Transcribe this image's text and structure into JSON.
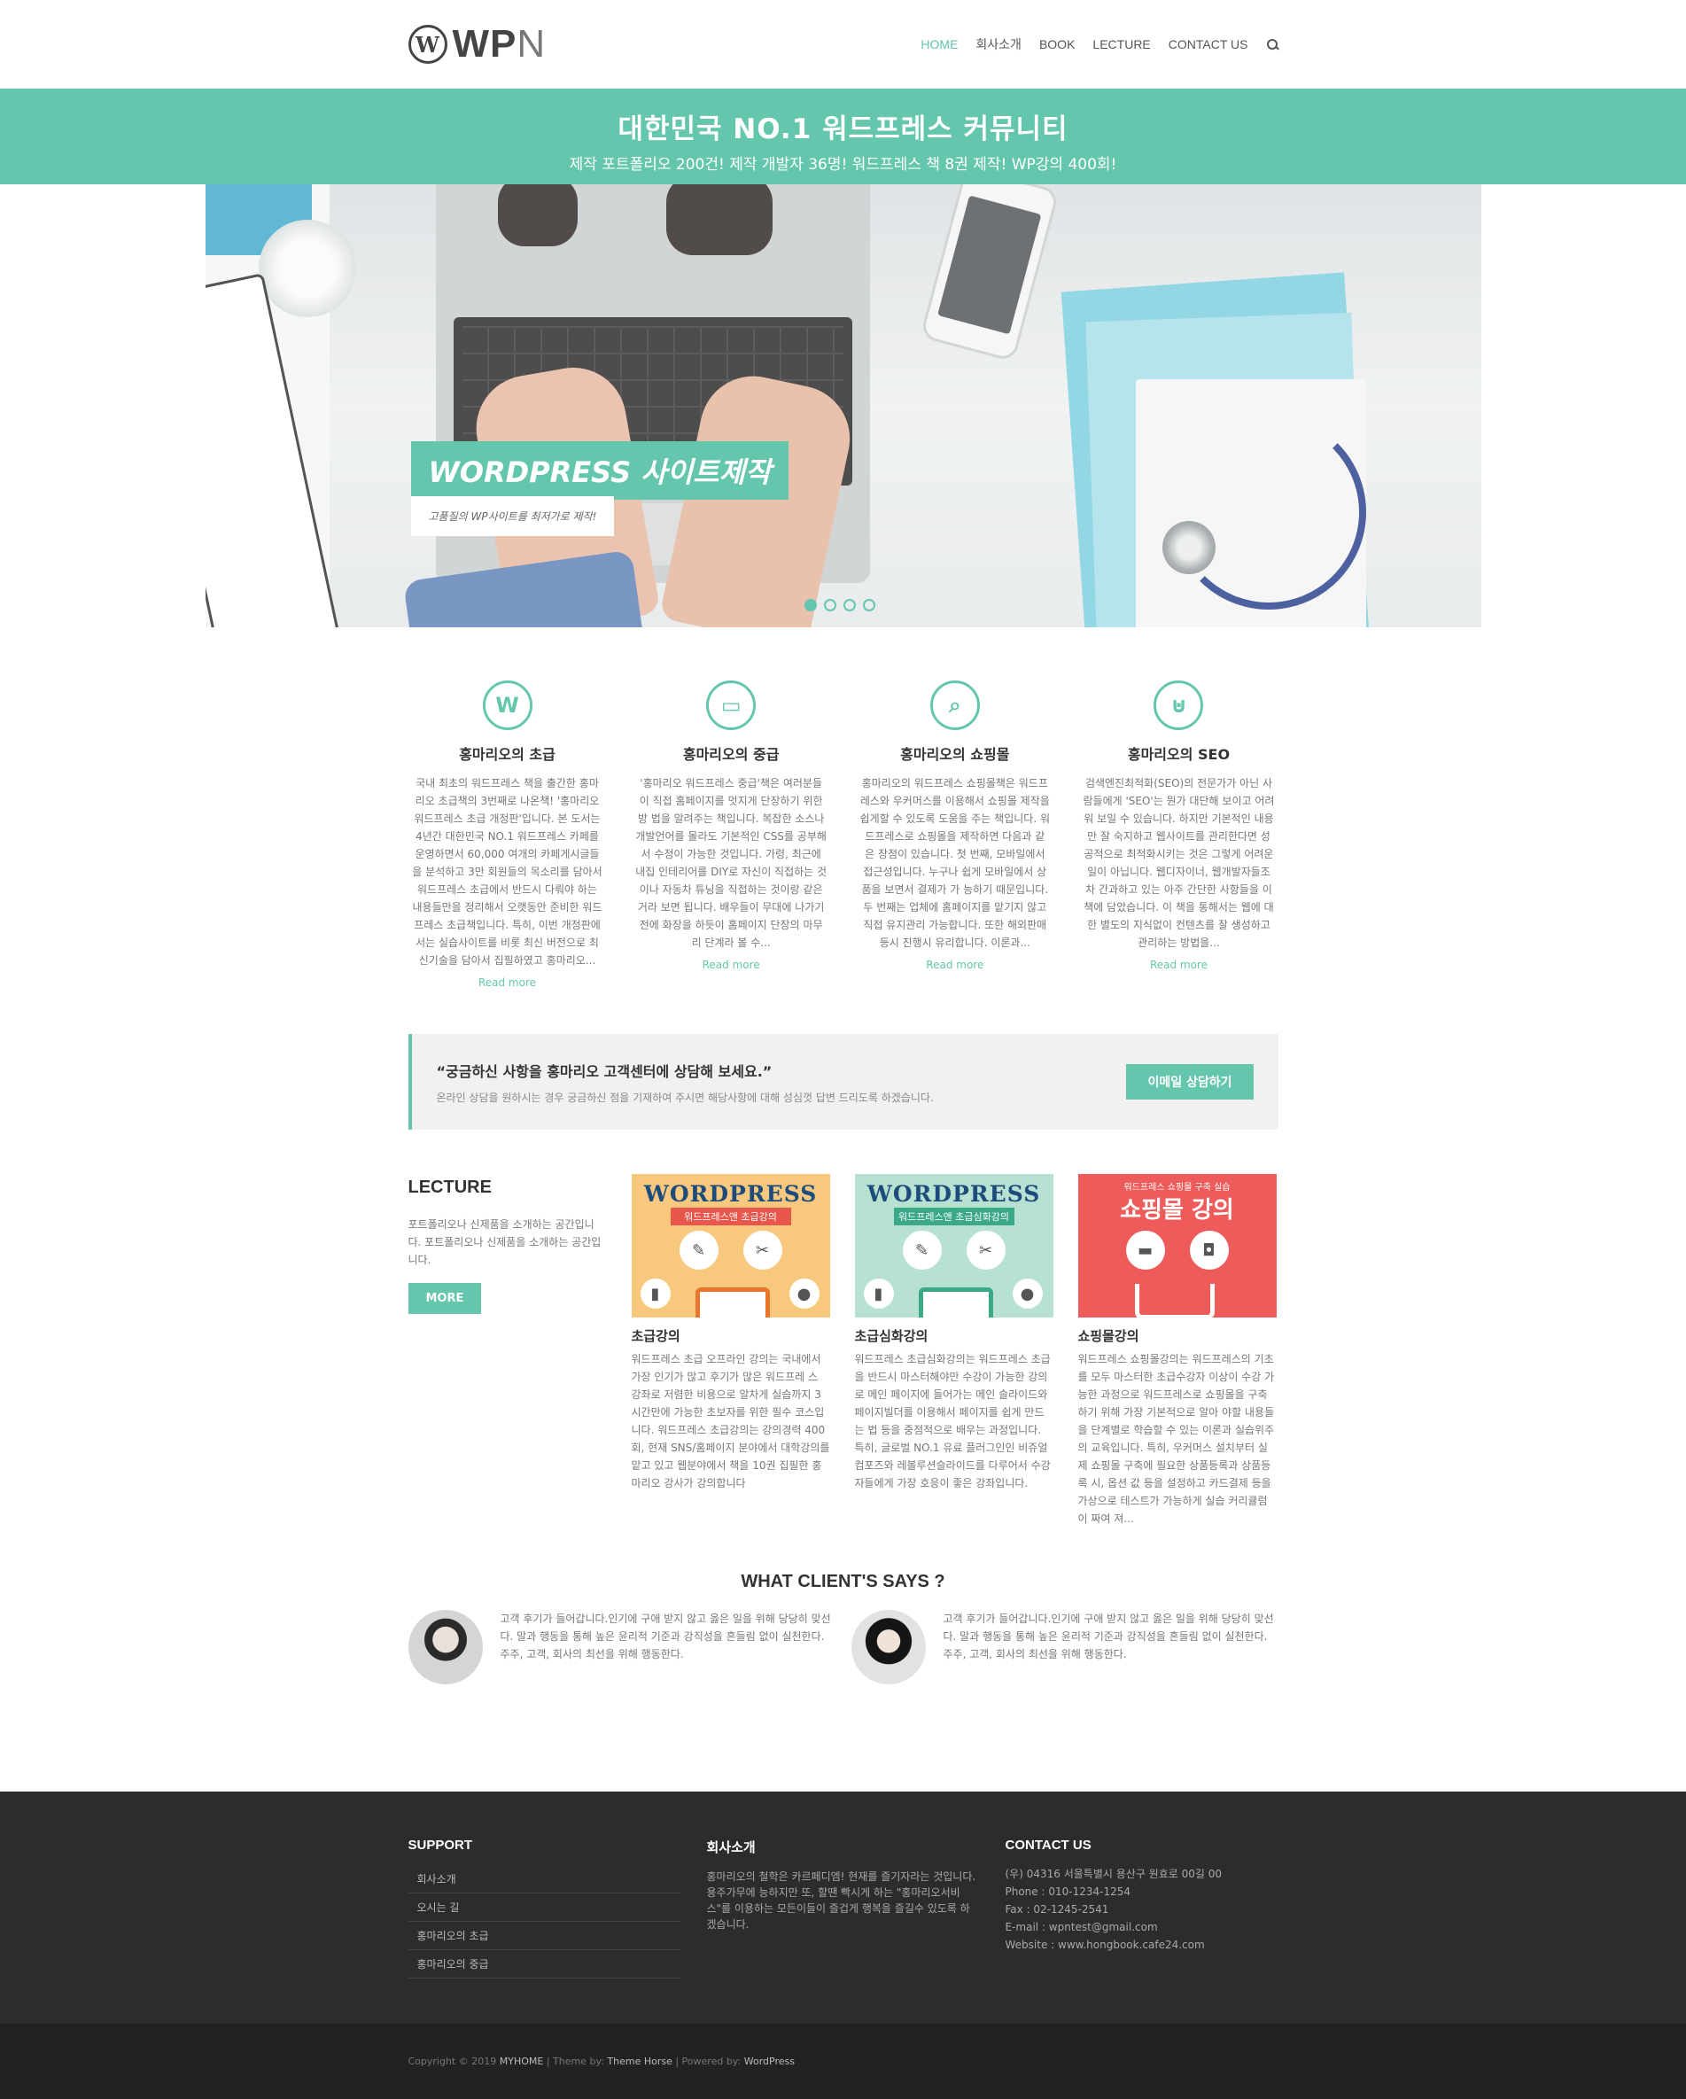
{
  "header": {
    "logo_text_main": "WP",
    "logo_text_n": "N",
    "logo_symbol": "W",
    "nav": [
      "HOME",
      "회사소개",
      "BOOK",
      "LECTURE",
      "CONTACT US"
    ],
    "active_nav": "HOME",
    "search_icon": "search-icon"
  },
  "banner": {
    "title": "대한민국 NO.1 워드프레스 커뮤니티",
    "subtitle": "제작 포트폴리오 200건! 제작 개발자 36명! 워드프레스 책 8권 제작! WP강의 400회!"
  },
  "hero": {
    "caption_title": "WORDPRESS 사이트제작",
    "caption_sub": "고품질의 WP사이트를 최저가로 제작!",
    "slide_count": 4,
    "active_slide": 1
  },
  "features": [
    {
      "icon": "wordpress-icon",
      "glyph": "W",
      "title": "홍마리오의 초급",
      "text": "국내 최초의 워드프레스 책을 출간한 홍마리오 초급책의 3번째로 나온책! '홍마리오 워드프레스 초급 개정판'입니다. 본 도서는 4년간 대한민국 NO.1 워드프레스 카페를 운영하면서 60,000 여개의 카페게시글들을 분석하고 3만 회원들의 목소리를 담아서 워드프레스 초급에서 반드시 다뤄야 하는 내용들만을 정리해서 오랫동안 준비한 워드프레스 초급책입니다. 특히, 이번 개정판에서는 실습사이트를 비롯 최신 버전으로 최신기술을 담아서 집필하였고 홍마리오...",
      "more": "Read more"
    },
    {
      "icon": "monitor-icon",
      "glyph": "▭",
      "title": "홍마리오의 중급",
      "text": "'홍마리오 워드프레스 중급'책은 여러분들이 직접 홈페이지를 멋지게 단장하기 위한 방 법을 알려주는 책입니다. 복잡한 소스나 개발언어를 몰라도 기본적인 CSS를 공부해서 수정이 가능한 것입니다. 가령, 최근에 내집 인테리어를 DIY로 자신이 직접하는 것이나 자동차 튜닝을 직접하는 것이랑 같은거라 보면 됩니다. 배우들이 무대에 나가기 전에 화장을 하듯이 홈페이지 단장의 마무리 단계라 볼 수...",
      "more": "Read more"
    },
    {
      "icon": "search-icon",
      "glyph": "⌕",
      "title": "홍마리오의 쇼핑몰",
      "text": "홍마리오의 워드프레스 쇼핑몰책은 워드프레스와 우커머스를 이용해서 쇼핑몰 제작을 쉽게할 수 있도록 도움을 주는 책입니다. 워드프레스로 쇼핑몰을 제작하면 다음과 같 은 장점이 있습니다. 첫 번째, 모바일에서 접근성입니다. 누구나 쉽게 모바일에서 상품을 보면서 결제가 가 능하기 때문입니다. 두 번째는 업체에 홈페이지를 맡기지 않고 직접 유지관리 가능합니다. 또한 해외판매 등시 진행시 유리합니다. 이론과...",
      "more": "Read more"
    },
    {
      "icon": "basket-icon",
      "glyph": "⊍",
      "title": "홍마리오의 SEO",
      "text": "검색엔진최적화(SEO)의 전문가가 아닌 사람들에게 'SEO'는 뭔가 대단해 보이고 어려 워 보일 수 있습니다. 하지만 기본적인 내용만 잘 숙지하고 웹사이트를 관리한다면 성공적으로 최적화시키는 것은 그렇게 어려운 일이 아닙니다. 웹디자이너, 웹개발자들조차 간과하고 있는 아주 간단한 사항들을 이 책에 담았습니다. 이 책을 통해서는 웹에 대한 별도의 지식없이 컨텐츠를 잘 생성하고 관리하는 방법을...",
      "more": "Read more"
    }
  ],
  "callout": {
    "title": "“궁금하신 사항을 홍마리오 고객센터에 상담해 보세요.”",
    "text": "온라인 상담을 원하시는 경우 궁금하신 점을 기재하여 주시면 해당사항에 대해 성심껏 답변 드리도록 하겠습니다.",
    "button": "이메일 상담하기"
  },
  "lecture": {
    "title": "LECTURE",
    "text": "포트폴리오나 신제품을 소개하는 공간입니다. 포트폴리오나 신제품을 소개하는 공간입니다.",
    "button": "MORE",
    "cards": [
      {
        "thumb_brand": "WORDPRESS",
        "thumb_ribbon": "워드프레스앤 초급강의",
        "title": "초급강의",
        "text": "워드프레스 초급 오프라인 강의는 국내에서 가장 인기가 많고 후기가 많은 워드프레 스 강좌로 저렴한 비용으로 알차게 실습까지 3시간만에 가능한 초보자를 위한 필수 코스입니다. 워드프레스 초급강의는 강의경력 400회, 현재 SNS/홈페이지 분야에서 대학강의를 맡고 있고 웹분야에서 책을 10권 집필한 홍마리오 강사가 강의합니다"
      },
      {
        "thumb_brand": "WORDPRESS",
        "thumb_ribbon": "워드프레스앤 초급심화강의",
        "title": "초급심화강의",
        "text": "워드프레스 초급심화강의는 워드프레스 초급을 반드시 마스터해야만 수강이 가능한 강의로 메인 페이지에 들어가는 메인 슬라이드와 페이지빌더를 이용해서 페이지를 쉽게 만드는 법 등을 중점적으로 배우는 과정입니다. 특히, 글로벌 NO.1 유료 플러그인인 비쥬얼컴포즈와 레볼루션슬라이드를 다루어서 수강자들에게 가장 호응이 좋은 강좌입니다."
      },
      {
        "thumb_small": "워드프레스 쇼핑몰 구축 실습",
        "thumb_title": "쇼핑몰 강의",
        "title": "쇼핑몰강의",
        "text": "워드프레스 쇼핑몰강의는 워드프레스의 기초를 모두 마스터한 초급수강자 이상이 수강 가능한 과정으로 워드프레스로 쇼핑몰을 구축하기 위해 가장 기본적으로 알아 야할 내용들을 단계별로 학습할 수 있는 이론과 실습위주의 교육입니다. 특히, 우커머스 설치부터 실제 쇼핑몰 구축에 필요한 상품등록과 상품등록 시, 옵션 값 등을 설정하고 카드결제 등을 가상으로 테스트가 가능하게 실습 커리큘럼이 짜여 져..."
      }
    ]
  },
  "clients": {
    "title": "WHAT CLIENT'S SAYS ?",
    "items": [
      {
        "text": "고객 후기가 들어갑니다.인기에 구애 받지 않고 옳은 일을 위해 당당히 맞선다. 말과 행동을 통해 높은 윤리적 기준과 강직성을 흔들림 없이 실천한다. 주주, 고객, 회사의 최선을 위해 행동한다."
      },
      {
        "text": "고객 후기가 들어갑니다.인기에 구애 받지 않고 옳은 일을 위해 당당히 맞선다. 말과 행동을 통해 높은 윤리적 기준과 강직성을 흔들림 없이 실천한다. 주주, 고객, 회사의 최선을 위해 행동한다."
      }
    ]
  },
  "footer": {
    "support_title": "SUPPORT",
    "support_links": [
      "회사소개",
      "오시는 길",
      "홍마리오의 초급",
      "홍마리오의 중급"
    ],
    "about_title": "회사소개",
    "about_text": "홍마리오의 철학은 카르페디엠! 현재를 즐기자라는 것입니다. 용주가무에 능하지만 또, 할땐 빡시게 하는 \"홍마리오서비스\"를 이용하는 모든이들이 즐겁게 행복을 즐길수 있도록 하겠습니다.",
    "contact_title": "CONTACT US",
    "contact_lines": [
      "(우) 04316 서울특별시 용산구 원효로 00길 00",
      "Phone : 010-1234-1254",
      "Fax : 02-1245-2541",
      "E-mail : wpntest@gmail.com",
      "Website : www.hongbook.cafe24.com"
    ]
  },
  "bottombar": {
    "copyright": "Copyright © 2019",
    "site": "MYHOME",
    "theme_prefix": "| Theme by:",
    "theme": "Theme Horse",
    "powered_prefix": "| Powered by:",
    "powered": "WordPress"
  },
  "colors": {
    "accent": "#64c7ad",
    "footer_bg": "#2c2c2c",
    "bottom_bg": "#222222"
  }
}
